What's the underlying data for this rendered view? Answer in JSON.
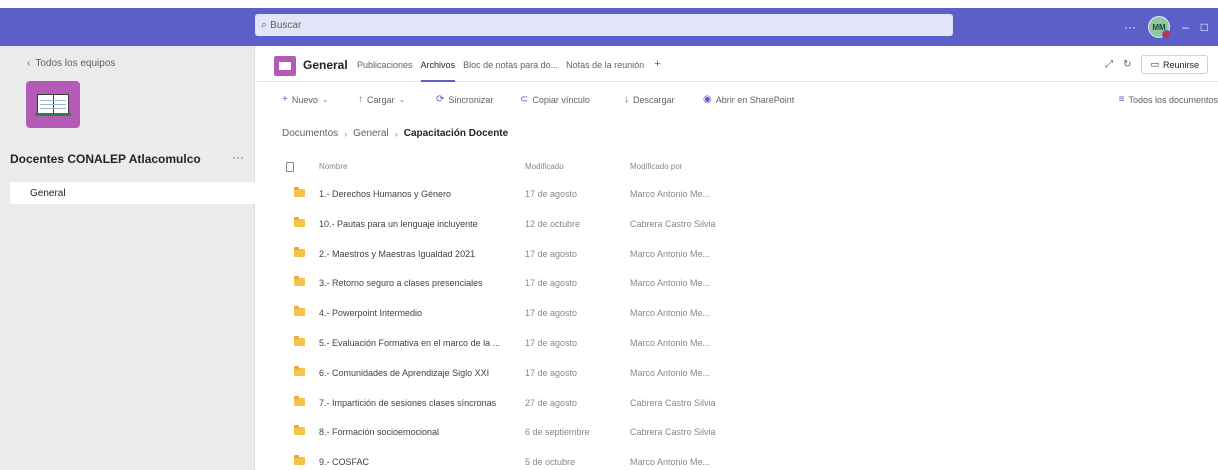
{
  "topbar": {
    "search_placeholder": "Buscar",
    "more": "···",
    "avatar_initials": "MM",
    "minimize": "–",
    "maximize": "□"
  },
  "sidebar": {
    "back_label": "Todos los equipos",
    "team_name": "Docentes CONALEP Atlacomulco",
    "team_more": "···",
    "channels": [
      {
        "label": "General"
      }
    ]
  },
  "channel": {
    "title": "General",
    "tabs": [
      {
        "label": "Publicaciones"
      },
      {
        "label": "Archivos"
      },
      {
        "label": "Bloc de notas para do..."
      },
      {
        "label": "Notas de la reunión"
      }
    ],
    "add_tab": "+",
    "expand_icon": "⤢",
    "refresh_icon": "↻",
    "meet_label": "Reunirse"
  },
  "toolbar": {
    "nuevo": "Nuevo",
    "cargar": "Cargar",
    "sincronizar": "Sincronizar",
    "copiar": "Copiar vínculo",
    "descargar": "Descargar",
    "sharepoint": "Abrir en SharePoint",
    "todos": "Todos los documentos"
  },
  "breadcrumb": [
    "Documentos",
    "General",
    "Capacitación Docente"
  ],
  "table": {
    "headers": {
      "name": "Nombre",
      "modified": "Modificado",
      "modified_by": "Modificado por"
    },
    "rows": [
      {
        "name": "1.- Derechos Humanos y Género",
        "modified": "17 de agosto",
        "modified_by": "Marco Antonio Me..."
      },
      {
        "name": "10.- Pautas para un lenguaje incluyente",
        "modified": "12 de octubre",
        "modified_by": "Cabrera Castro Silvia"
      },
      {
        "name": "2.- Maestros y Maestras Igualdad 2021",
        "modified": "17 de agosto",
        "modified_by": "Marco Antonio Me..."
      },
      {
        "name": "3.- Retorno seguro a clases presenciales",
        "modified": "17 de agosto",
        "modified_by": "Marco Antonio Me..."
      },
      {
        "name": "4.- Powerpoint Intermedio",
        "modified": "17 de agosto",
        "modified_by": "Marco Antonio Me..."
      },
      {
        "name": "5.- Evaluación Formativa en el marco de la ...",
        "modified": "17 de agosto",
        "modified_by": "Marco Antonio Me..."
      },
      {
        "name": "6.- Comunidades de Aprendizaje Siglo XXI",
        "modified": "17 de agosto",
        "modified_by": "Marco Antonio Me..."
      },
      {
        "name": "7.- Impartición de sesiones clases síncronas",
        "modified": "27 de agosto",
        "modified_by": "Cabrera Castro Silvia"
      },
      {
        "name": "8.- Formación socioemocional",
        "modified": "6 de septiembre",
        "modified_by": "Cabrera Castro Silvia"
      },
      {
        "name": "9.- COSFAC",
        "modified": "5 de octubre",
        "modified_by": "Marco Antonio Me..."
      }
    ]
  },
  "colors": {
    "brand": "#5b5fc7",
    "team": "#b45bb8",
    "folder": "#f4c34a"
  }
}
